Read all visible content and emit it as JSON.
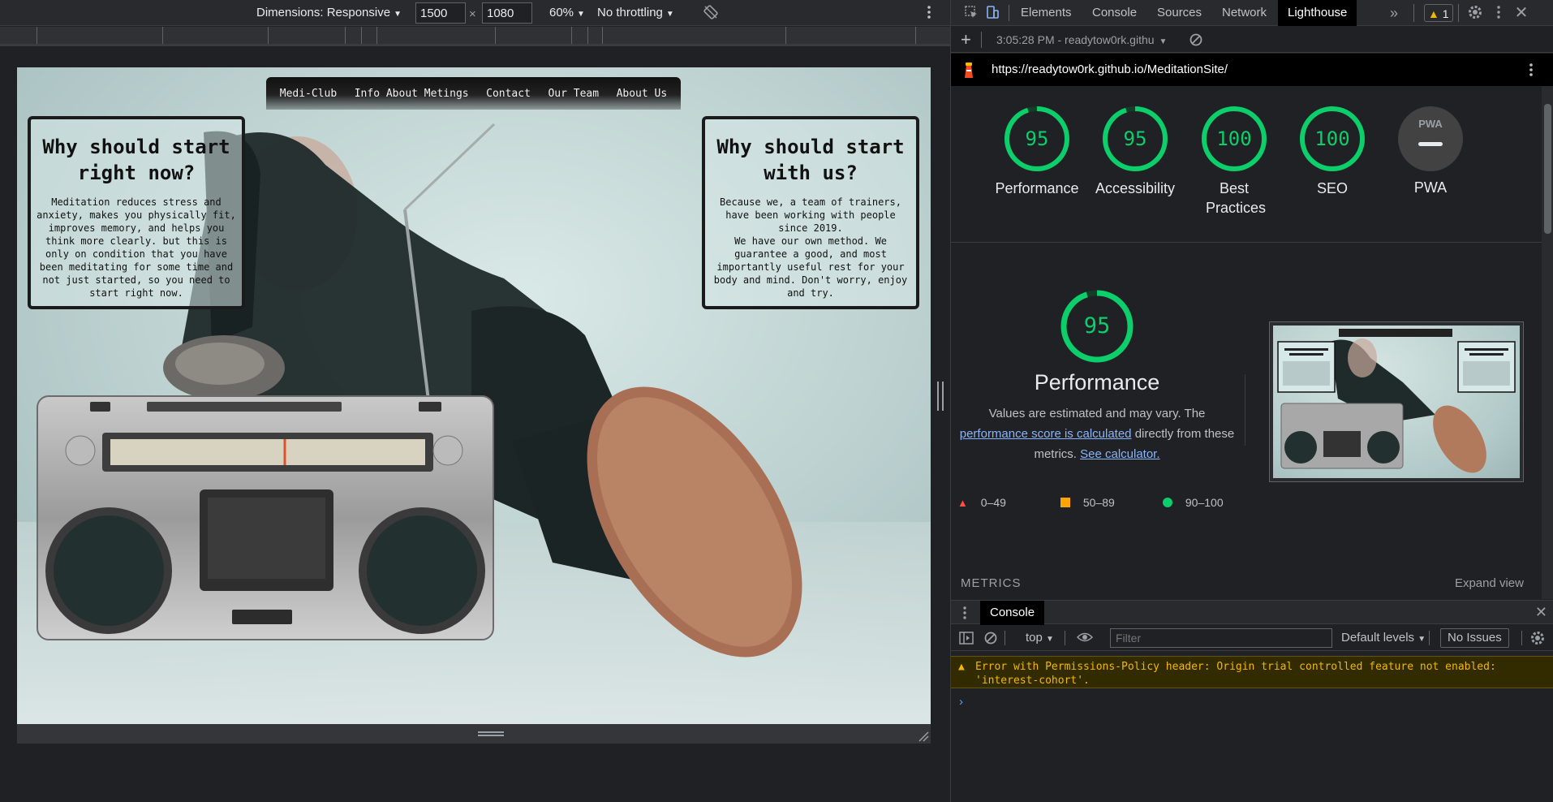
{
  "device_toolbar": {
    "dimensions_label": "Dimensions: Responsive",
    "width_value": "1500",
    "times": "×",
    "height_value": "1080",
    "zoom": "60%",
    "throttling": "No throttling",
    "rotate_icon": "rotate-icon",
    "more_icon": "more-vertical-icon"
  },
  "site": {
    "nav": [
      "Medi-Club",
      "Info About Metings",
      "Contact",
      "Our Team",
      "About Us"
    ],
    "card_left": {
      "title": "Why should start right now?",
      "body": "Meditation reduces stress and anxiety, makes you physically fit, improves memory, and helps you think more clearly. but this is only on condition that you have been meditating for some time and not just started, so you need to start right now."
    },
    "card_right": {
      "title": "Why should start with us?",
      "body_1": "Because we, a team of trainers, have been working with people since 2019.",
      "body_2": "We have our own method. We guarantee a good, and most importantly useful rest for your body and mind. Don't worry, enjoy and try."
    }
  },
  "devtools": {
    "tabs": [
      "Elements",
      "Console",
      "Sources",
      "Network",
      "Lighthouse"
    ],
    "active_tab": "Lighthouse",
    "warning_count": "1",
    "report_selector": "3:05:28 PM - readytow0rk.githu",
    "url": "https://readytow0rk.github.io/MeditationSite/",
    "scores": [
      {
        "label": "Performance",
        "value": "95"
      },
      {
        "label": "Accessibility",
        "value": "95"
      },
      {
        "label": "Best Practices",
        "value": "100"
      },
      {
        "label": "SEO",
        "value": "100"
      }
    ],
    "pwa": {
      "badge": "PWA",
      "label": "PWA"
    },
    "performance": {
      "score": "95",
      "title": "Performance",
      "desc_1": "Values are estimated and may vary. The",
      "desc_link": "performance score is calculated",
      "desc_2": "directly from these metrics.",
      "calc_link": "See calculator."
    },
    "legend": [
      "0–49",
      "50–89",
      "90–100"
    ],
    "metrics_label": "METRICS",
    "expand_label": "Expand view",
    "colors": {
      "pass": "#0cce6b",
      "average": "#ffa400",
      "fail": "#ff4e42"
    }
  },
  "console": {
    "tab": "Console",
    "context": "top",
    "filter_placeholder": "Filter",
    "levels": "Default levels",
    "issues": "No Issues",
    "warning": "Error with Permissions-Policy header: Origin trial controlled feature not enabled: 'interest-cohort'.",
    "prompt": "›"
  }
}
